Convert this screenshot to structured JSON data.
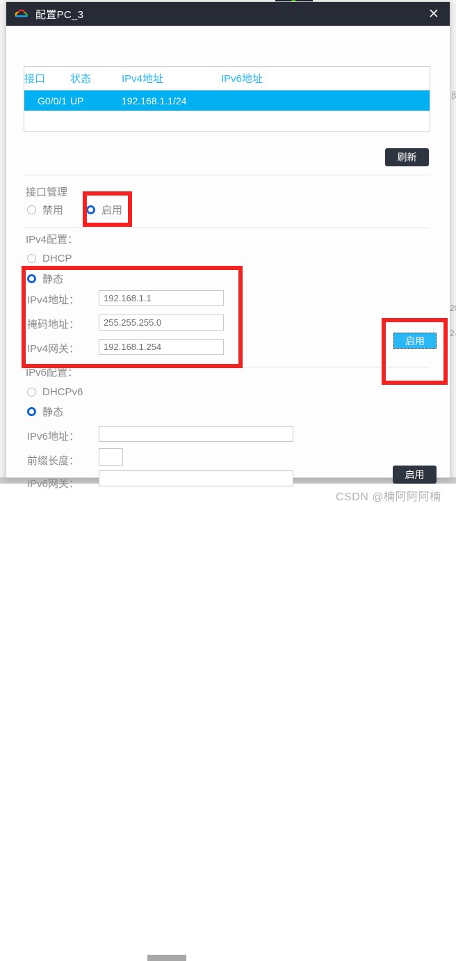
{
  "window": {
    "title": "配置PC_3",
    "icon": "cloud-icon",
    "close_label": "✕"
  },
  "table": {
    "columns": [
      "接口",
      "状态",
      "IPv4地址",
      "IPv6地址"
    ],
    "rows": [
      {
        "interface": "G0/0/1",
        "state": "UP",
        "ipv4": "192.168.1.1/24",
        "ipv6": "",
        "selected": true
      }
    ],
    "empty_row_count": 1
  },
  "refresh_button": {
    "label": "刷新"
  },
  "interface_management": {
    "label": "接口管理",
    "options": [
      {
        "label": "禁用",
        "checked": false
      },
      {
        "label": "启用",
        "checked": true
      }
    ]
  },
  "ipv4_config": {
    "label": "IPv4配置：",
    "mode_options": [
      {
        "label": "DHCP",
        "checked": false
      },
      {
        "label": "静态",
        "checked": true
      }
    ],
    "fields": [
      {
        "label": "IPv4地址：",
        "value": "192.168.1.1",
        "placeholder": ""
      },
      {
        "label": "掩码地址：",
        "value": "255.255.255.0",
        "placeholder": ""
      },
      {
        "label": "IPv4网关：",
        "value": "192.168.1.254",
        "placeholder": ""
      }
    ],
    "apply_label": "启用"
  },
  "ipv6_config": {
    "label": "IPv6配置：",
    "mode_options": [
      {
        "label": "DHCPv6",
        "checked": false
      },
      {
        "label": "静态",
        "checked": true
      }
    ],
    "fields": [
      {
        "label": "IPv6地址：",
        "value": "",
        "placeholder": ""
      },
      {
        "label": "前缀长度：",
        "value": "",
        "placeholder": ""
      },
      {
        "label": "IPv6网关：",
        "value": "",
        "placeholder": ""
      }
    ],
    "apply_label": "启用"
  },
  "background": {
    "faint_text_1": "反",
    "faint_text_2": "20",
    "faint_text_3": "2-"
  },
  "watermark": {
    "text": "CSDN @楠阿阿阿楠"
  },
  "colors": {
    "accent_blue": "#00b0f0",
    "header_blue": "#29b8f5",
    "titlebar": "#262b36",
    "dark_button": "#2e3440",
    "annotation_red": "#f52222",
    "radio_checked": "#1565d8"
  }
}
